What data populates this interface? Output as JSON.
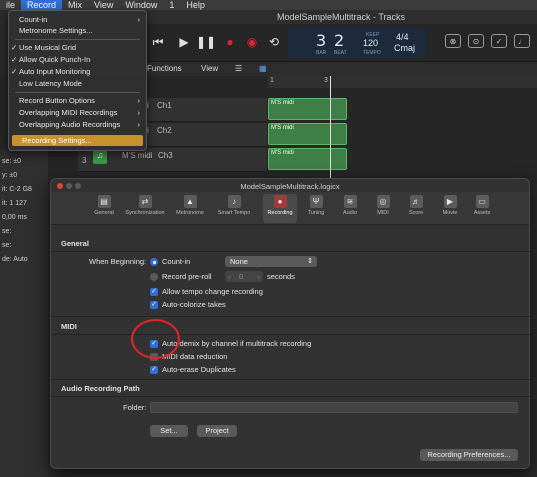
{
  "menubar": {
    "items": [
      "ile",
      "Record",
      "Mix",
      "View",
      "Window",
      "1",
      "Help"
    ]
  },
  "record_menu": {
    "items": [
      {
        "label": "Count-in",
        "checked": false,
        "submenu": true
      },
      {
        "label": "Metronome Settings...",
        "checked": false,
        "submenu": false
      },
      {
        "label": "Use Musical Grid",
        "checked": true,
        "submenu": false
      },
      {
        "label": "Allow Quick Punch-In",
        "checked": true,
        "submenu": false
      },
      {
        "label": "Auto Input Monitoring",
        "checked": true,
        "submenu": false
      },
      {
        "label": "Low Latency Mode",
        "checked": false,
        "submenu": false
      },
      {
        "label": "Record Button Options",
        "checked": false,
        "submenu": true
      },
      {
        "label": "Overlapping MIDI Recordings",
        "checked": false,
        "submenu": true
      },
      {
        "label": "Overlapping Audio Recordings",
        "checked": false,
        "submenu": true
      },
      {
        "label": "Recording Settings...",
        "checked": false,
        "submenu": false,
        "highlighted": true
      }
    ],
    "check_glyph": "✓",
    "arrow_glyph": "›"
  },
  "main_window": {
    "title": "ModelSampleMultitrack - Tracks",
    "lcd": {
      "bar": "3",
      "beat": "2",
      "bar_label": "BAR",
      "beat_label": "BEAT",
      "tempo": "120",
      "tempo_top": "KEEP",
      "tempo_label": "TEMPO",
      "signature": "4/4",
      "key": "Cmaj"
    },
    "functions_label": "Functions",
    "view_label": "View",
    "ruler_marks": [
      "1",
      "3"
    ],
    "tracks": [
      {
        "name": "i",
        "channel": "Ch1",
        "region": "M'S midi"
      },
      {
        "name": "i",
        "channel": "Ch2",
        "region": "M'S midi"
      },
      {
        "number": "3",
        "name": "M'S midi",
        "channel": "Ch3",
        "region": "M'S midi"
      }
    ],
    "left_panel": [
      "se: ±0",
      "y: ±0",
      "it: C-2  G8",
      "it: 1  127",
      "0,00 ms",
      "se:",
      "se:",
      "de: Auto"
    ]
  },
  "dialog": {
    "title": "ModelSampleMultitrack.logicx",
    "tabs": [
      "General",
      "Synchronization",
      "Metronome",
      "Smart Tempo",
      "Recording",
      "Tuning",
      "Audio",
      "MIDI",
      "Score",
      "Movie",
      "Assets"
    ],
    "active_tab": "Recording",
    "general": {
      "heading": "General",
      "when_beginning_label": "When Beginning:",
      "count_in_label": "Count-in",
      "count_in_value": "None",
      "preroll_label": "Record pre-roll",
      "preroll_value": "0",
      "seconds_label": "seconds",
      "allow_tempo_label": "Allow tempo change recording",
      "auto_colorize_label": "Auto-colorize takes"
    },
    "midi": {
      "heading": "MIDI",
      "auto_demix_label": "Auto demix by channel if multitrack recording",
      "data_reduction_label": "MIDI data reduction",
      "auto_erase_label": "Auto-erase Duplicates"
    },
    "audio_path": {
      "heading": "Audio Recording Path",
      "folder_label": "Folder:",
      "folder_value": "",
      "set_button": "Set...",
      "project_button": "Project"
    },
    "recording_prefs_button": "Recording Preferences..."
  },
  "colors": {
    "accent": "#2f6fd6",
    "highlight": "#c7922b",
    "annotation": "#e0252a"
  }
}
